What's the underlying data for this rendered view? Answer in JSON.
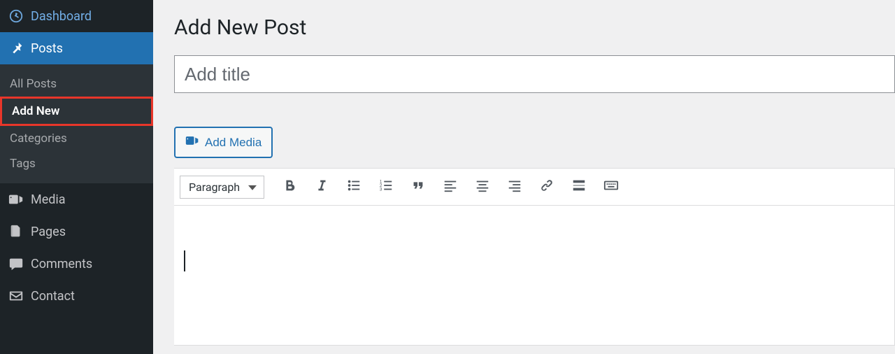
{
  "sidebar": {
    "dashboard": {
      "label": "Dashboard"
    },
    "posts": {
      "label": "Posts",
      "submenu": {
        "all_posts": "All Posts",
        "add_new": "Add New",
        "categories": "Categories",
        "tags": "Tags"
      }
    },
    "media": {
      "label": "Media"
    },
    "pages": {
      "label": "Pages"
    },
    "comments": {
      "label": "Comments"
    },
    "contact": {
      "label": "Contact"
    }
  },
  "main": {
    "heading": "Add New Post",
    "title_placeholder": "Add title",
    "add_media_label": "Add Media",
    "format_selector": "Paragraph"
  }
}
